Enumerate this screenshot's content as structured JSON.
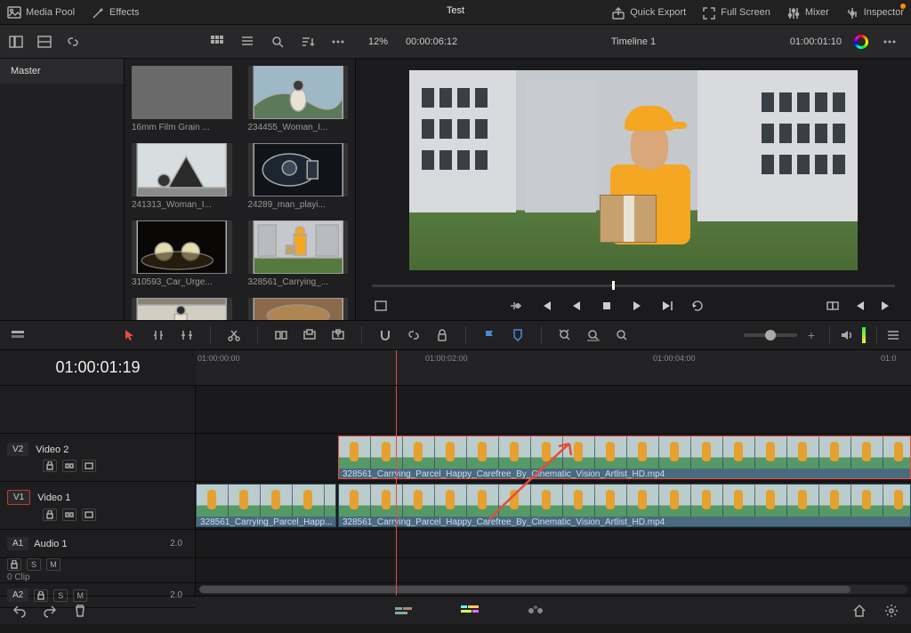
{
  "top": {
    "mediaPool": "Media Pool",
    "effects": "Effects",
    "title": "Test",
    "quickExport": "Quick Export",
    "fullScreen": "Full Screen",
    "mixer": "Mixer",
    "inspector": "Inspector"
  },
  "viewerHeader": {
    "zoom": "12%",
    "sourceTC": "00:00:06:12",
    "timelineName": "Timeline 1",
    "recordTC": "01:00:01:10"
  },
  "master": "Master",
  "clips": [
    {
      "label": "16mm Film Grain ..."
    },
    {
      "label": "234455_Woman_I..."
    },
    {
      "label": "241313_Woman_I..."
    },
    {
      "label": "24289_man_playi..."
    },
    {
      "label": "310593_Car_Urge..."
    },
    {
      "label": "328561_Carrying_..."
    }
  ],
  "timecode": "01:00:01:19",
  "ruler": [
    "01:00:00:00",
    "01:00:02:00",
    "01:00:04:00",
    "01:0"
  ],
  "tracks": {
    "v2": {
      "tag": "V2",
      "name": "Video 2"
    },
    "v1": {
      "tag": "V1",
      "name": "Video 1"
    },
    "a1": {
      "tag": "A1",
      "name": "Audio 1",
      "val": "2.0"
    },
    "a2": {
      "tag": "A2",
      "val": "2.0"
    },
    "zeroClip": "0 Clip"
  },
  "timelineClips": {
    "v2": "328561_Carrying_Parcel_Happy_Carefree_By_Cinematic_Vision_Artlist_HD.mp4",
    "v1a": "328561_Carrying_Parcel_Happ...",
    "v1b": "328561_Carrying_Parcel_Happy_Carefree_By_Cinematic_Vision_Artlist_HD.mp4"
  },
  "playheadPercent": 28
}
